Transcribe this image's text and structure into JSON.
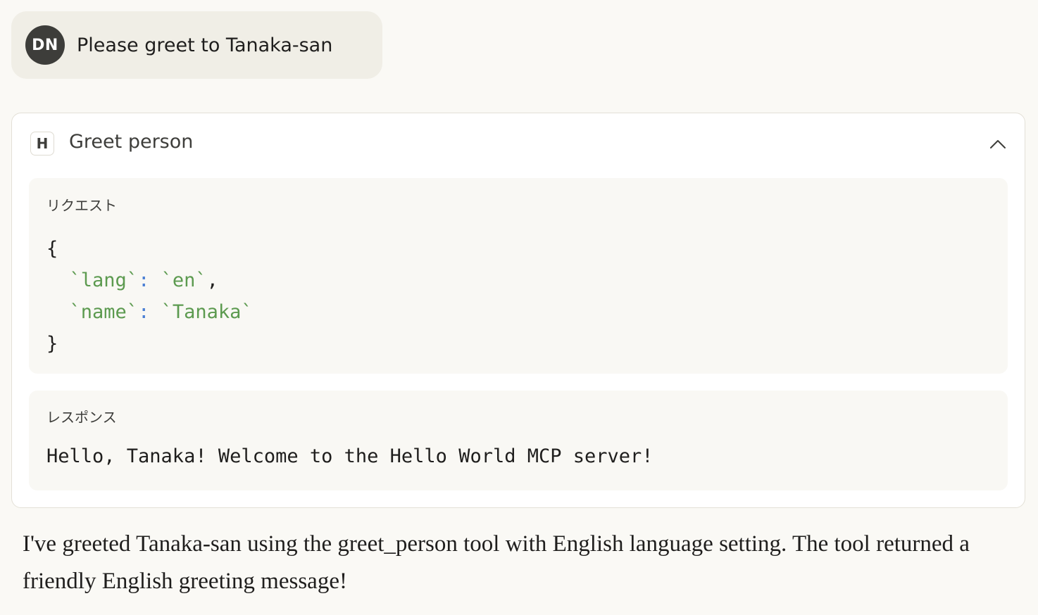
{
  "user_message": {
    "avatar_initials": "DN",
    "text": "Please greet to Tanaka-san"
  },
  "tool_call": {
    "badge": "H",
    "title": "Greet person",
    "collapse_icon": "chevron-up-icon",
    "request": {
      "label": "リクエスト",
      "open_brace": "{",
      "close_brace": "}",
      "params": [
        {
          "key": "`lang`",
          "value": "`en`",
          "trailing": ","
        },
        {
          "key": "`name`",
          "value": "`Tanaka`",
          "trailing": ""
        }
      ]
    },
    "response": {
      "label": "レスポンス",
      "text": "Hello, Tanaka! Welcome to the Hello World MCP server!"
    }
  },
  "assistant_message": {
    "text": "I've greeted Tanaka-san using the greet_person tool with English language setting. The tool returned a friendly English greeting message!"
  },
  "colors": {
    "page_background": "#faf9f5",
    "user_bubble": "#f0eee6",
    "avatar_background": "#3d3d3a",
    "code_string": "#5c9a4f",
    "code_punctuation": "#4a7fd4"
  }
}
